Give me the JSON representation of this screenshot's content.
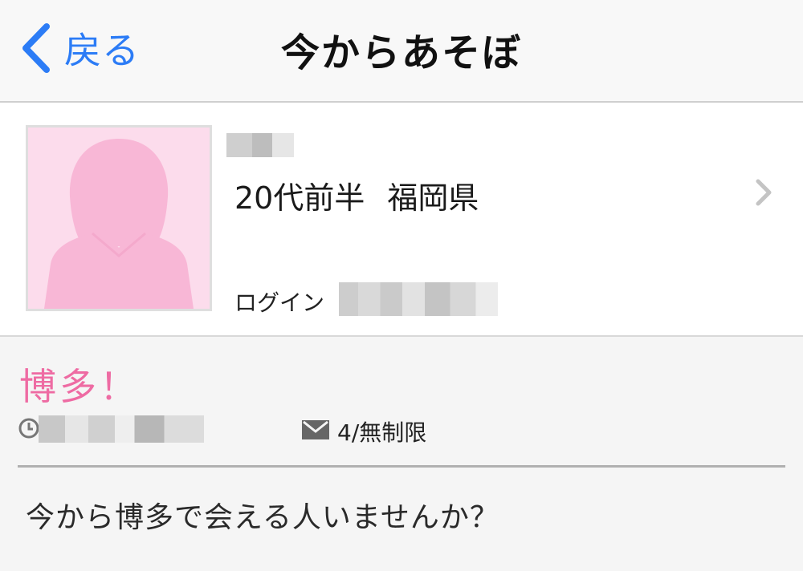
{
  "nav": {
    "back_label": "戻る",
    "title": "今からあそぼ"
  },
  "profile": {
    "age": "20代前半",
    "location": "福岡県",
    "login_label": "ログイン",
    "avatar": "female-silhouette-placeholder"
  },
  "post": {
    "title": "博多！",
    "mail_count": "4/無制限",
    "body": "今から博多で会える人いませんか？"
  },
  "colors": {
    "accent_blue": "#2c7cf6",
    "title_pink": "#ee6ba3",
    "avatar_bg": "#fcdcec",
    "avatar_silhouette": "#f8b7d6"
  },
  "icons": {
    "back": "chevron-left-icon",
    "forward": "chevron-right-icon",
    "time": "clock-icon",
    "mail": "mail-icon"
  }
}
